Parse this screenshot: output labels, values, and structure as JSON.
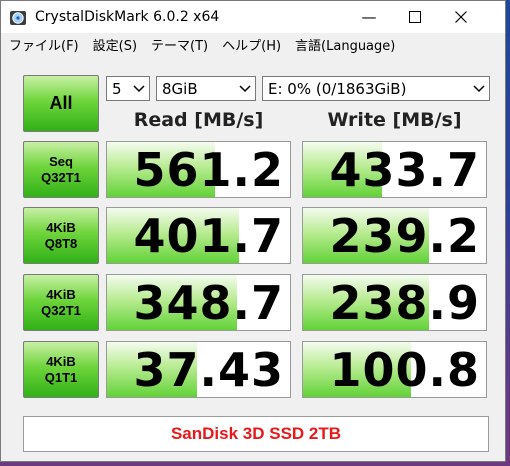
{
  "window": {
    "title": "CrystalDiskMark 6.0.2 x64"
  },
  "menu": {
    "items": [
      {
        "label": "ファイル(F)"
      },
      {
        "label": "設定(S)"
      },
      {
        "label": "テーマ(T)"
      },
      {
        "label": "ヘルプ(H)"
      },
      {
        "label": "言語(Language)"
      }
    ]
  },
  "controls": {
    "all_label": "All",
    "count": "5",
    "size": "8GiB",
    "drive": "E: 0% (0/1863GiB)"
  },
  "headers": {
    "read": "Read [MB/s]",
    "write": "Write [MB/s]"
  },
  "tests": [
    {
      "line1": "Seq",
      "line2": "Q32T1",
      "read": "561.2",
      "write": "433.7",
      "read_fill": 0.59,
      "write_fill": 0.43
    },
    {
      "line1": "4KiB",
      "line2": "Q8T8",
      "read": "401.7",
      "write": "239.2",
      "read_fill": 0.72,
      "write_fill": 0.69
    },
    {
      "line1": "4KiB",
      "line2": "Q32T1",
      "read": "348.7",
      "write": "238.9",
      "read_fill": 0.71,
      "write_fill": 0.69
    },
    {
      "line1": "4KiB",
      "line2": "Q1T1",
      "read": "37.43",
      "write": "100.8",
      "read_fill": 0.49,
      "write_fill": 0.59
    }
  ],
  "comment": "SanDisk 3D SSD 2TB",
  "colors": {
    "accent_green": "#31b017",
    "comment_red": "#e8191a"
  }
}
